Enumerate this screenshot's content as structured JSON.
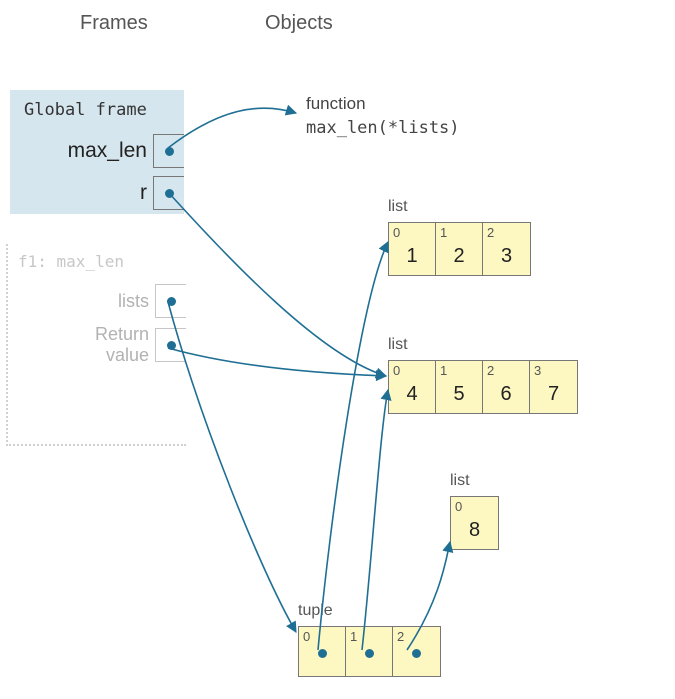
{
  "headers": {
    "frames": "Frames",
    "objects": "Objects"
  },
  "global_frame": {
    "title": "Global frame",
    "vars": {
      "max_len": "max_len",
      "r": "r"
    }
  },
  "f1_frame": {
    "title": "f1: max_len",
    "vars": {
      "lists": "lists",
      "return": "Return\nvalue"
    }
  },
  "function_obj": {
    "type_label": "function",
    "signature": "max_len(*lists)"
  },
  "list1": {
    "label": "list",
    "indices": [
      "0",
      "1",
      "2"
    ],
    "values": [
      "1",
      "2",
      "3"
    ]
  },
  "list2": {
    "label": "list",
    "indices": [
      "0",
      "1",
      "2",
      "3"
    ],
    "values": [
      "4",
      "5",
      "6",
      "7"
    ]
  },
  "list3": {
    "label": "list",
    "indices": [
      "0"
    ],
    "values": [
      "8"
    ]
  },
  "tuple": {
    "label": "tuple",
    "indices": [
      "0",
      "1",
      "2"
    ]
  },
  "arrows": {
    "color": "#1f6f94",
    "paths": [
      "M 168 148 C 220 108, 260 102, 296 113",
      "M 168 192 C 230 260, 320 356, 386 376",
      "M 168 302 C 200 420, 260 570, 296 632",
      "M 168 348 C 240 368, 330 374, 386 376",
      "M 318 650 C 330 520, 360 300, 388 242",
      "M 362 650 C 372 560, 380 430, 388 390",
      "M 407 650 C 440 600, 446 560, 450 542"
    ]
  }
}
